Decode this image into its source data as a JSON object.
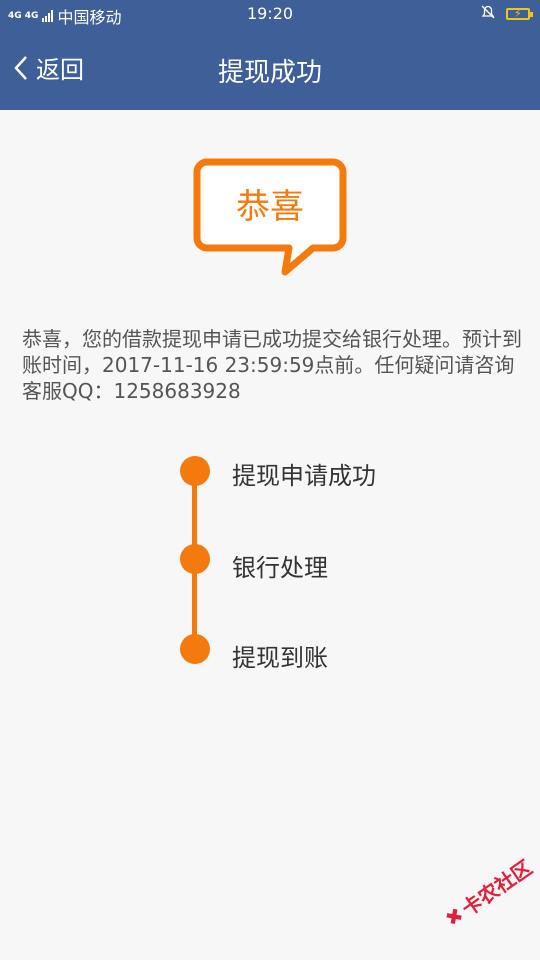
{
  "status_bar": {
    "signal_label": "4G 4G",
    "carrier": "中国移动",
    "time": "19:20"
  },
  "nav": {
    "back_label": "返回",
    "title": "提现成功"
  },
  "bubble": {
    "text": "恭喜"
  },
  "message": "恭喜，您的借款提现申请已成功提交给银行处理。预计到账时间，2017-11-16 23:59:59点前。任何疑问请咨询客服QQ：1258683928",
  "steps": [
    {
      "label": "提现申请成功"
    },
    {
      "label": "银行处理"
    },
    {
      "label": "提现到账"
    }
  ],
  "watermark": {
    "text": "卡农社区"
  },
  "colors": {
    "header": "#3e5f98",
    "accent": "#f47a0e",
    "background": "#f7f7f7"
  }
}
